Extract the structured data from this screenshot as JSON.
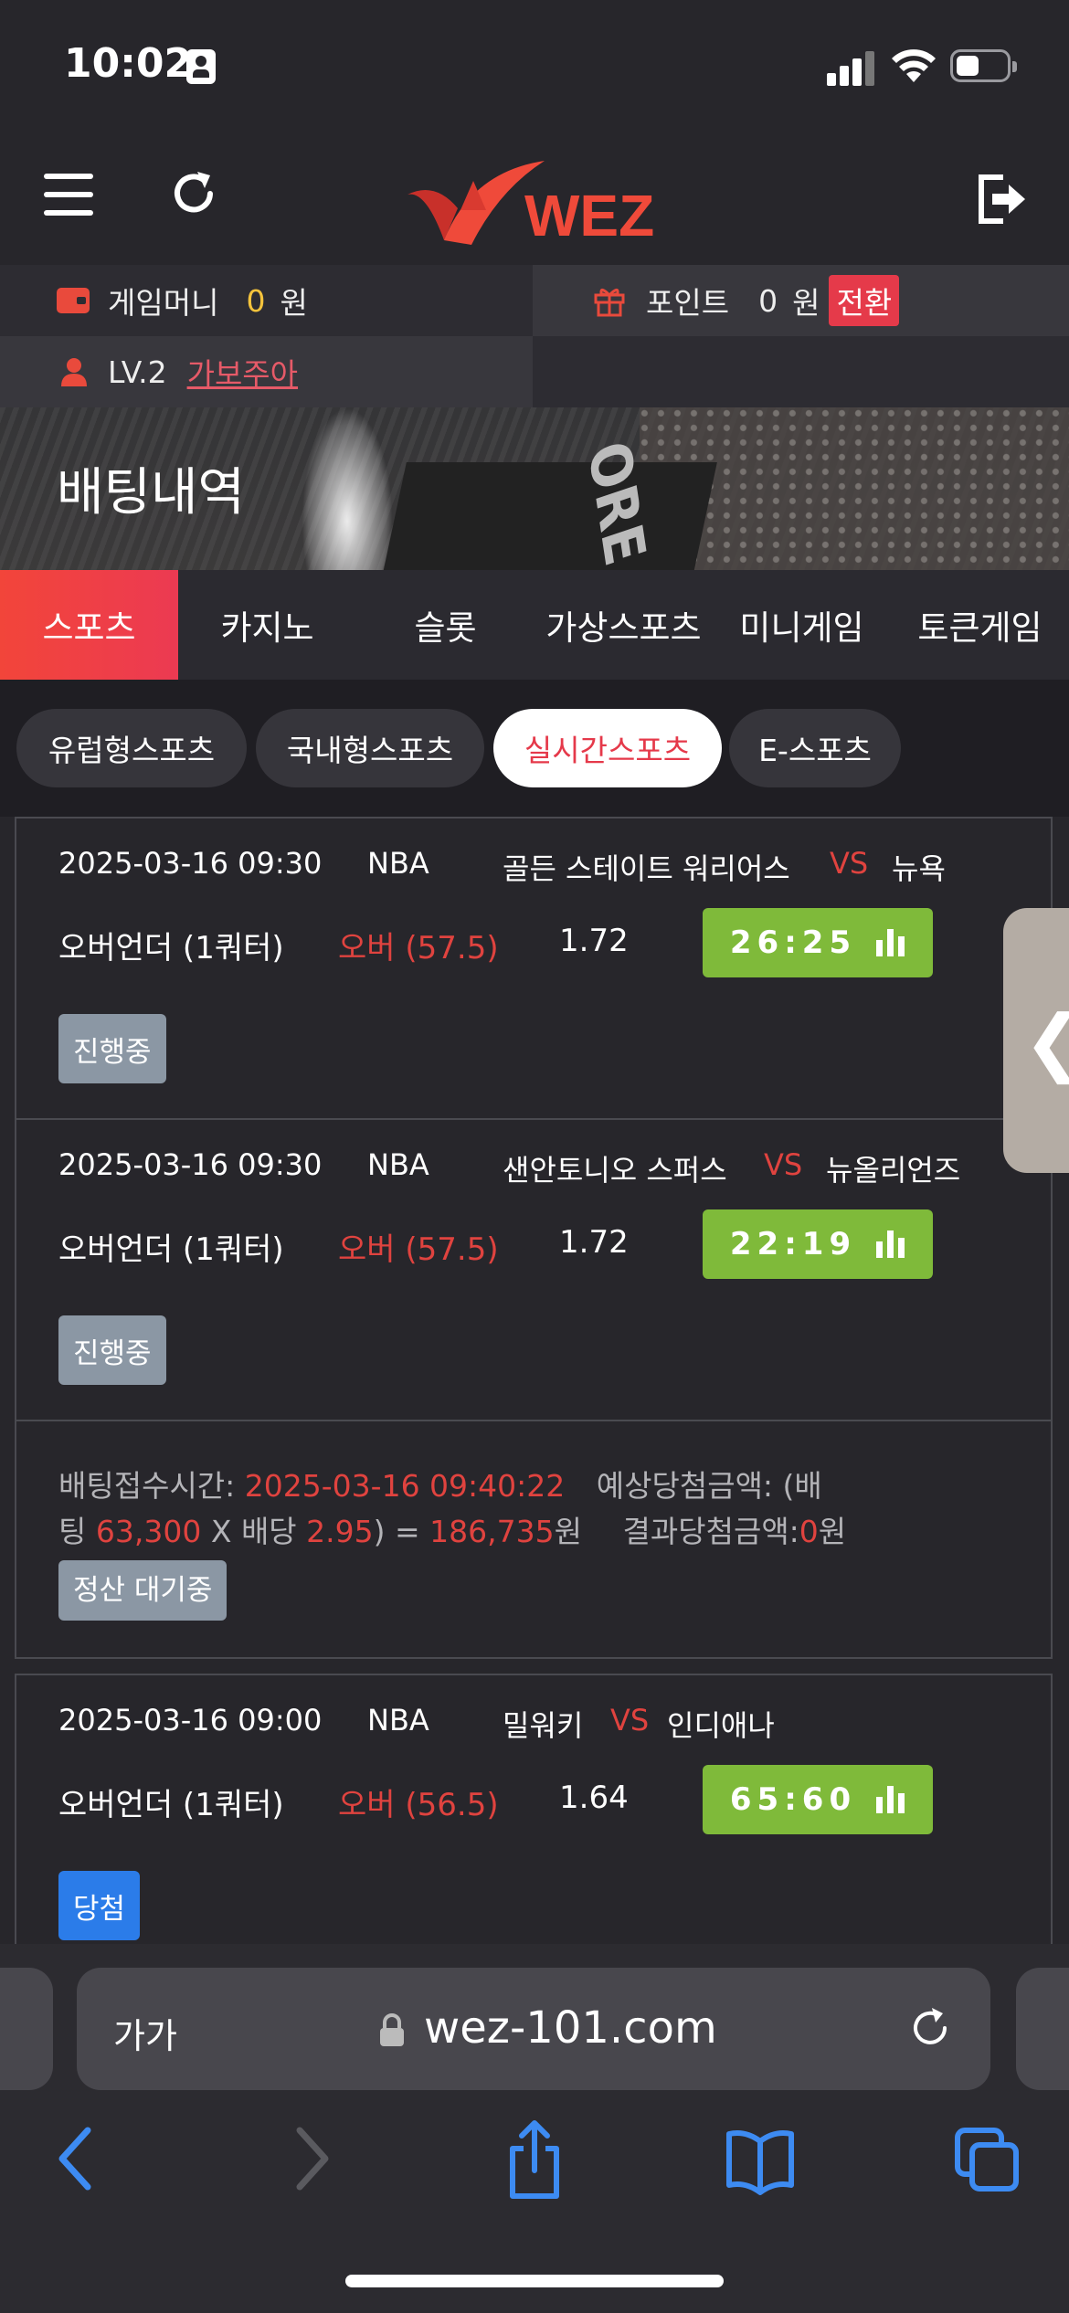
{
  "status_bar": {
    "time": "10:02"
  },
  "header": {
    "logo_text": "WEZ"
  },
  "account": {
    "game_money_label": "게임머니",
    "game_money_value": "0",
    "won": "원",
    "point_label": "포인트",
    "point_value": "0",
    "point_unit": "원",
    "convert_label": "전환",
    "level": "LV.2",
    "nickname": "가보주아"
  },
  "banner": {
    "title": "배팅내역",
    "stadium_text": "ORE"
  },
  "category_tabs": [
    "스포츠",
    "카지노",
    "슬롯",
    "가상스포츠",
    "미니게임",
    "토큰게임"
  ],
  "sub_tabs": [
    "유럽형스포츠",
    "국내형스포츠",
    "실시간스포츠",
    "E-스포츠"
  ],
  "bets": [
    {
      "games": [
        {
          "datetime": "2025-03-16 09:30",
          "league": "NBA",
          "home": "골든 스테이트 워리어스",
          "vs": "VS",
          "away": "뉴욕",
          "market": "오버언더 (1쿼터)",
          "pick": "오버 (57.5)",
          "odds": "1.72",
          "score": "26:25",
          "status": "진행중"
        },
        {
          "datetime": "2025-03-16 09:30",
          "league": "NBA",
          "home": "샌안토니오 스퍼스",
          "vs": "VS",
          "away": "뉴올리언즈",
          "market": "오버언더 (1쿼터)",
          "pick": "오버 (57.5)",
          "odds": "1.72",
          "score": "22:19",
          "status": "진행중"
        }
      ],
      "summary": {
        "bet_time_label": "배팅접수시간:",
        "bet_time": "2025-03-16 09:40:22",
        "expected_label": "예상당첨금액: (배",
        "expected_label_cont": "팅",
        "stake": "63,300",
        "x": "X 배당",
        "total_odds": "2.95",
        "close": ") =",
        "expected_amount": "186,735",
        "won": "원",
        "result_label": "결과당첨금액:",
        "result_amount": "0",
        "result_won": "원",
        "status": "정산 대기중"
      }
    },
    {
      "games": [
        {
          "datetime": "2025-03-16 09:00",
          "league": "NBA",
          "home": "밀워키",
          "vs": "VS",
          "away": "인디애나",
          "market": "오버언더 (1쿼터)",
          "pick": "오버 (56.5)",
          "odds": "1.64",
          "score": "65:60",
          "status": "당첨"
        }
      ]
    }
  ],
  "browser": {
    "aa_label": "가가",
    "url": "wez-101.com"
  },
  "colors": {
    "accent": "#e5394a",
    "score_green": "#7fba3a",
    "win_blue": "#2b7ce9",
    "pending_grey": "#8b97a4"
  }
}
